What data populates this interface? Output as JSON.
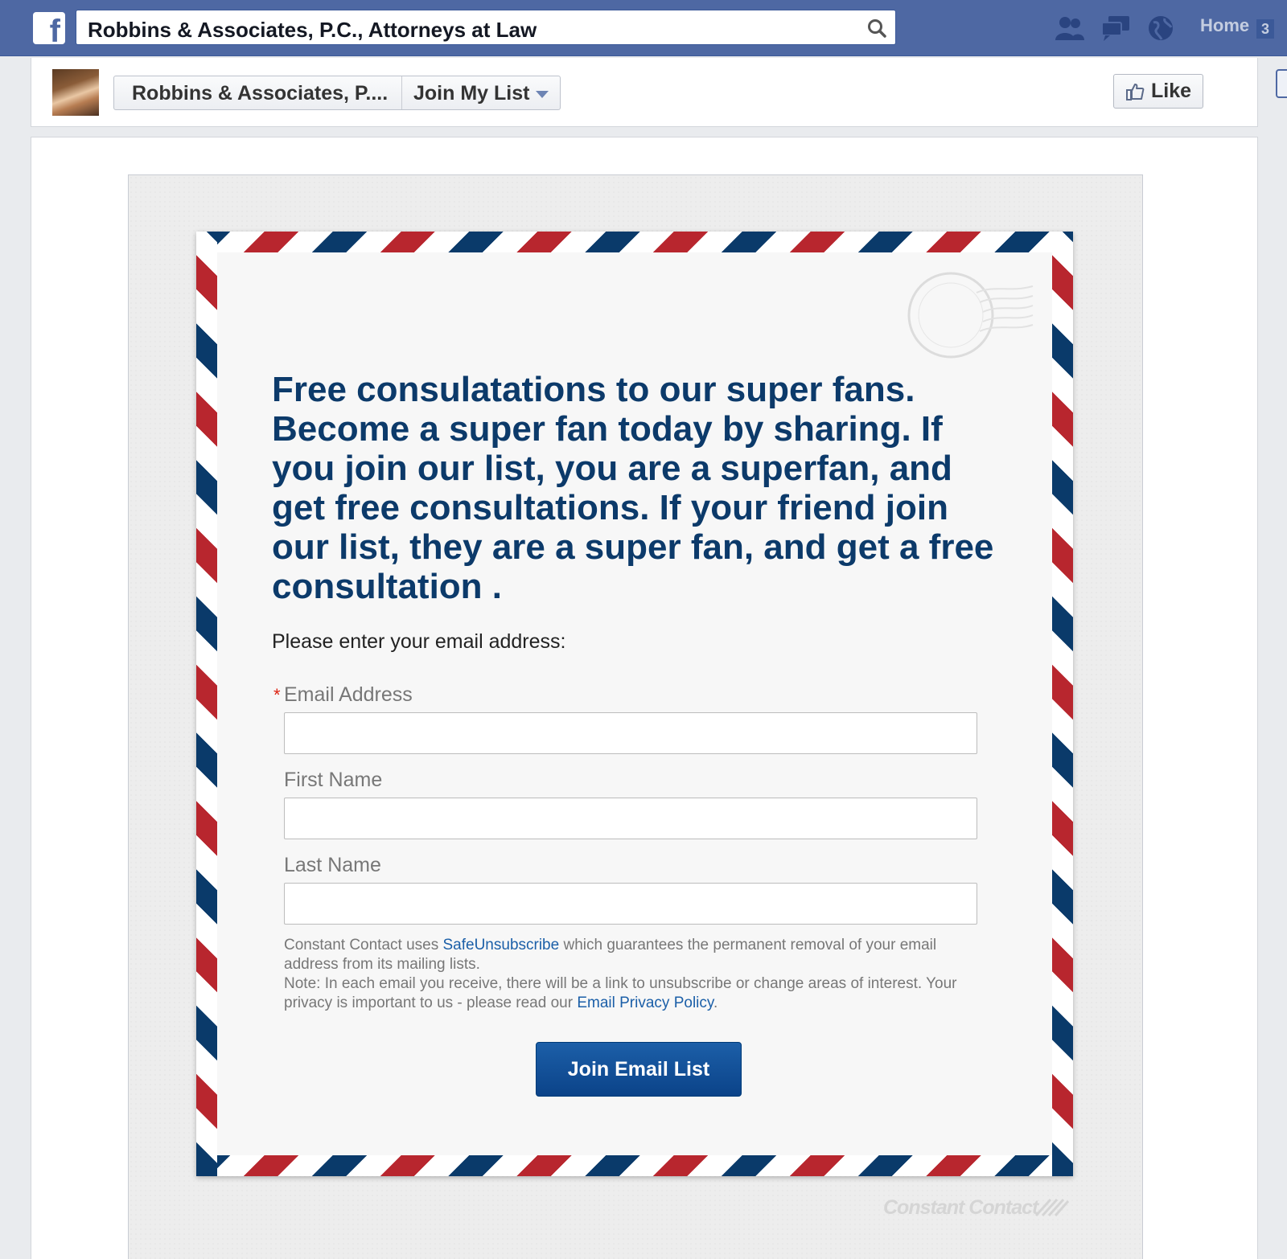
{
  "topbar": {
    "search_value": "Robbins & Associates, P.C., Attorneys at Law",
    "home_label": "Home",
    "notification_count": "3",
    "logo_letter": "f"
  },
  "page_header": {
    "page_name": "Robbins & Associates, P....",
    "tab_name": "Join My List",
    "like_label": "Like"
  },
  "form": {
    "headline": "Free consulatations to our super fans. Become a super fan today by sharing. If you join our list, you are a superfan, and get free consultations. If your friend join our list, they are a super fan, and get a free consultation .",
    "prompt": "Please enter your email address:",
    "required_marker": "*",
    "fields": [
      {
        "label": "Email Address",
        "value": ""
      },
      {
        "label": "First Name",
        "value": ""
      },
      {
        "label": "Last Name",
        "value": ""
      }
    ],
    "fine_print": {
      "part1": "Constant Contact uses ",
      "safeunsubscribe_link": "SafeUnsubscribe",
      "part2": " which guarantees the permanent removal of your email address from its mailing lists.",
      "part3": "Note: In each email you receive, there will be a link to unsubscribe or change areas of interest. Your privacy is important to us - please read our ",
      "privacy_link": "Email Privacy Policy",
      "part4": "."
    },
    "submit_label": "Join Email List"
  },
  "footer": {
    "brand": "Constant Contact"
  },
  "colors": {
    "facebook_blue": "#4e68a3",
    "headline_navy": "#0c3a6a",
    "stripe_red": "#b8262e",
    "stripe_blue": "#0a3a6a",
    "button_blue": "#1c5fa8"
  },
  "icons": [
    "facebook-logo-icon",
    "search-icon",
    "friend-requests-icon",
    "messages-icon",
    "notifications-globe-icon",
    "thumbs-up-icon",
    "chevron-down-icon",
    "postmark-stamp-icon",
    "constant-contact-logo-icon"
  ]
}
